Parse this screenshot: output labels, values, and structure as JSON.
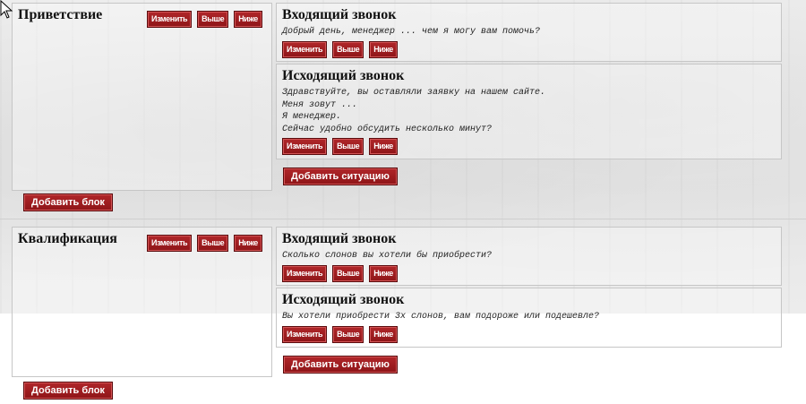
{
  "buttons": {
    "edit": "Изменить",
    "up": "Выше",
    "down": "Ниже",
    "add_situation": "Добавить ситуацию",
    "add_block": "Добавить блок"
  },
  "blocks": [
    {
      "title": "Приветствие",
      "situations": [
        {
          "title": "Входящий звонок",
          "text": "Добрый день, менеджер ... чем я могу вам помочь?"
        },
        {
          "title": "Исходящий звонок",
          "text": "Здравствуйте, вы оставляли заявку на нашем сайте.\nМеня зовут ...\nЯ менеджер.\nСейчас удобно обсудить несколько минут?"
        }
      ]
    },
    {
      "title": "Квалификация",
      "situations": [
        {
          "title": "Входящий звонок",
          "text": "Сколько слонов вы хотели бы приобрести?"
        },
        {
          "title": "Исходящий звонок",
          "text": "Вы хотели приобрести 3х слонов, вам подороже или подешевле?"
        }
      ]
    }
  ],
  "icons": {
    "cursor": "mouse-pointer-icon"
  },
  "colors": {
    "button_bg": "#9e1c1f",
    "button_text": "#ffffff",
    "panel_border": "#c6c6c6"
  }
}
